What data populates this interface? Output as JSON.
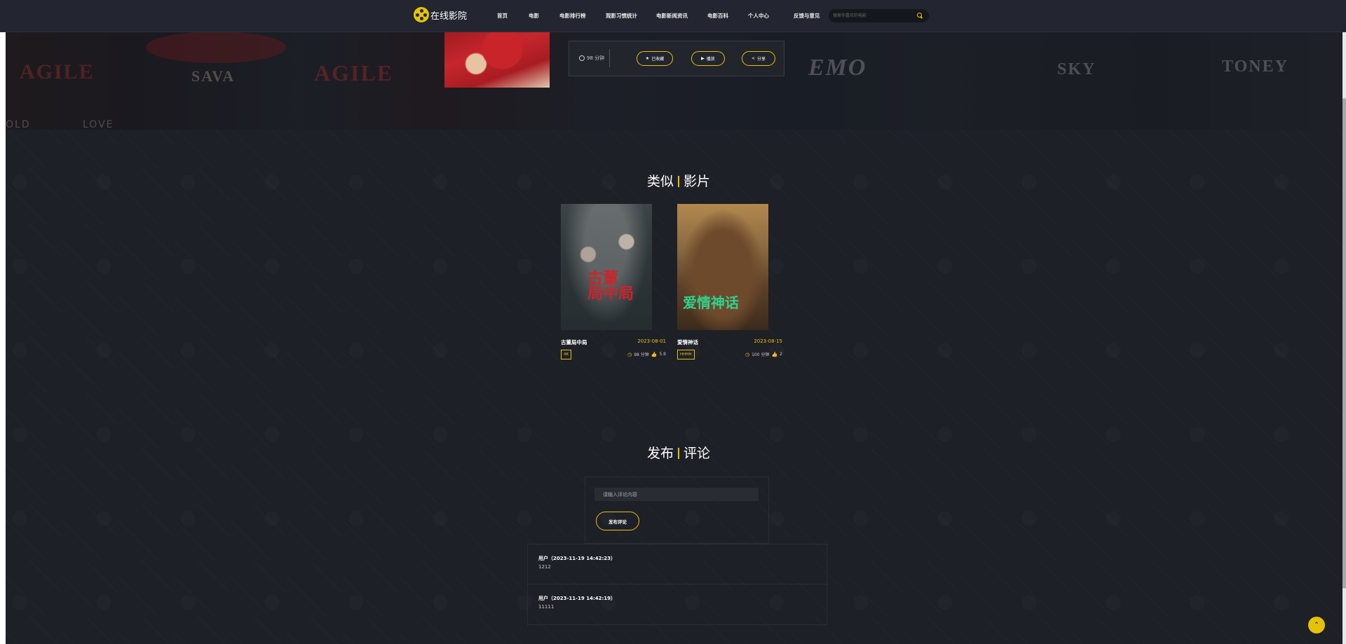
{
  "header": {
    "logo_text": "在线影院",
    "nav": [
      "首页",
      "电影",
      "电影排行榜",
      "观影习惯统计",
      "电影新闻资讯",
      "电影百科",
      "个人中心",
      "反馈与意见"
    ],
    "search_placeholder": "搜索你喜欢的电影"
  },
  "hero": {
    "background_words": [
      "AGILE",
      "SAVA",
      "AGILE",
      "EMO",
      "SKY",
      "TONEY",
      "OLD",
      "LOVE"
    ],
    "duration": "98 分钟",
    "buttons": {
      "collect": "已收藏",
      "play": "播放",
      "share": "分享"
    }
  },
  "similar": {
    "title_left": "类似",
    "title_right": "影片",
    "movies": [
      {
        "name": "古董局中局",
        "date": "2023-08-01",
        "badge": "4K",
        "duration": "98 分钟",
        "likes": "5.9",
        "poster_title": "古董\n局中局"
      },
      {
        "name": "爱情神话",
        "date": "2023-08-15",
        "badge": "HHHH",
        "duration": "100 分钟",
        "likes": "2",
        "poster_title": "爱情神话"
      }
    ]
  },
  "comments": {
    "title_left": "发布",
    "title_right": "评论",
    "input_placeholder": "请输入评论内容",
    "publish_label": "发布评论",
    "items": [
      {
        "user": "用户（2023-11-19 14:42:23）",
        "text": "1212"
      },
      {
        "user": "用户（2023-11-19 14:42:19）",
        "text": "11111"
      }
    ]
  },
  "colors": {
    "accent": "#e5c20a",
    "background": "#1e2028",
    "navbar": "#232530"
  },
  "icons": [
    "logo-film-reel-icon",
    "search-icon",
    "clock-icon",
    "star-icon",
    "play-icon",
    "share-icon",
    "thumbs-up-icon",
    "chevron-up-icon"
  ]
}
